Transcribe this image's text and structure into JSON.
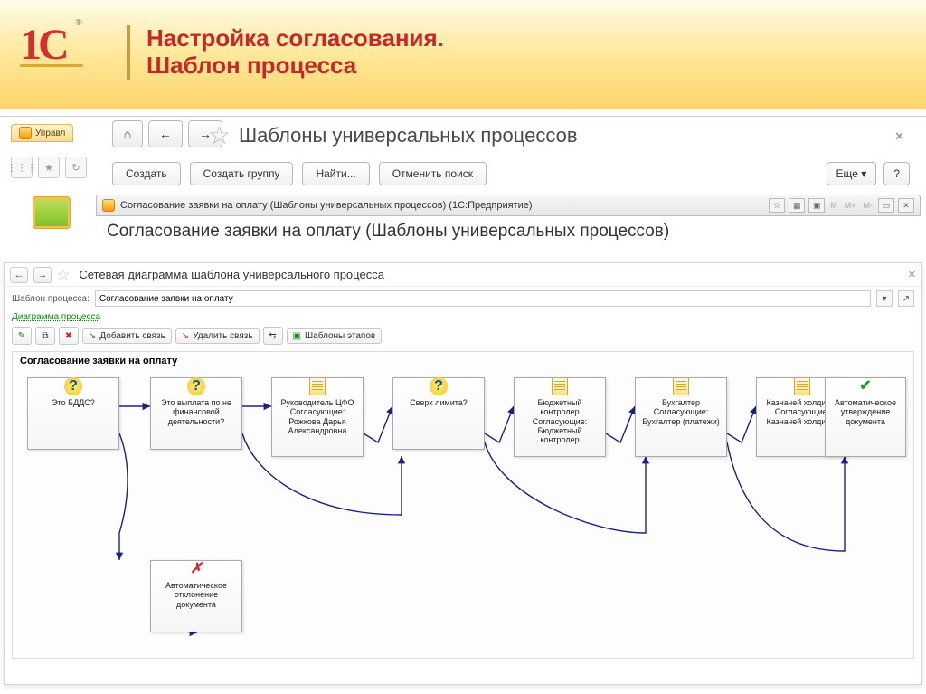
{
  "slide": {
    "title_line1": "Настройка согласования.",
    "title_line2": "Шаблон процесса",
    "logo_text": "1C"
  },
  "parent_window": {
    "tab_label": "Управл",
    "title": "Шаблоны универсальных процессов",
    "buttons": {
      "create": "Создать",
      "create_group": "Создать группу",
      "find": "Найти...",
      "cancel_search": "Отменить поиск",
      "more": "Еще",
      "help": "?"
    }
  },
  "modal": {
    "window_caption": "Согласование заявки на оплату (Шаблоны универсальных процессов)  (1С:Предприятие)",
    "title": "Согласование заявки на оплату (Шаблоны универсальных процессов)",
    "mem_m": "M",
    "mem_mp": "M+",
    "mem_mm": "M-"
  },
  "diagram": {
    "title": "Сетевая диаграмма шаблона универсального процесса",
    "template_field_label": "Шаблон процесса:",
    "template_field_value": "Согласование заявки на оплату",
    "section_label": "Диаграмма процесса",
    "toolbar": {
      "add_link": "Добавить связь",
      "del_link": "Удалить связь",
      "stage_templates": "Шаблоны этапов"
    },
    "canvas_title": "Согласование заявки на оплату",
    "nodes": {
      "n1": "Это БДДС?",
      "n2": "Это выплата по не финансовой деятельности?",
      "n3": "Руководитель ЦФО\nСогласующие:\nРожкова Дарья Александровна",
      "n4": "Сверх лимита?",
      "n5": "Бюджетный контролер\nСогласующие:\nБюджетный контролер",
      "n6": "Бухгалтер\nСогласующие:\nБухгалтер (платежи)",
      "n7": "Казначей холдинга\nСогласующие:\nКазначей холдинга",
      "n8": "Автоматическое утверждение документа",
      "n9": "Автоматическое отклонение документа"
    }
  }
}
